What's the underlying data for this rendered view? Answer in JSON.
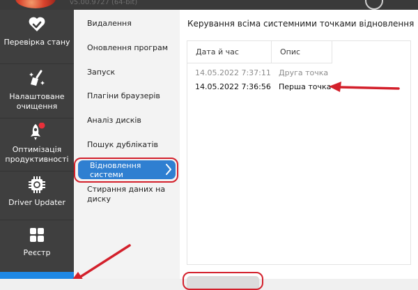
{
  "app": {
    "version": "v5.00.9727 (64-bit)"
  },
  "leftnav": {
    "items": [
      {
        "label": "Перевірка стану",
        "icon": "heart-check-icon"
      },
      {
        "label": "Налаштоване очищення",
        "icon": "broom-icon"
      },
      {
        "label": "Оптимізація продуктивності",
        "icon": "rocket-icon"
      },
      {
        "label": "Driver Updater",
        "icon": "driver-chip-icon"
      },
      {
        "label": "Реєстр",
        "icon": "grid-icon"
      }
    ],
    "active_color": "#1e88e5"
  },
  "subnav": {
    "items": [
      "Видалення",
      "Оновлення програм",
      "Запуск",
      "Плагіни браузерів",
      "Аналіз дисків",
      "Пошук дублікатів",
      "Відновлення системи",
      "Стирання даних на диску"
    ],
    "selected": "Відновлення системи",
    "selected_color": "#2f7fd1"
  },
  "main": {
    "title": "Керування всіма системними точками відновлення (на...",
    "columns": [
      "Дата й час",
      "Опис"
    ],
    "rows": [
      {
        "datetime": "14.05.2022 7:37:11",
        "description": "Друга точка"
      },
      {
        "datetime": "14.05.2022 7:36:56",
        "description": "Перша точка"
      }
    ]
  },
  "annotation": {
    "highlight_color": "#d3202b"
  }
}
